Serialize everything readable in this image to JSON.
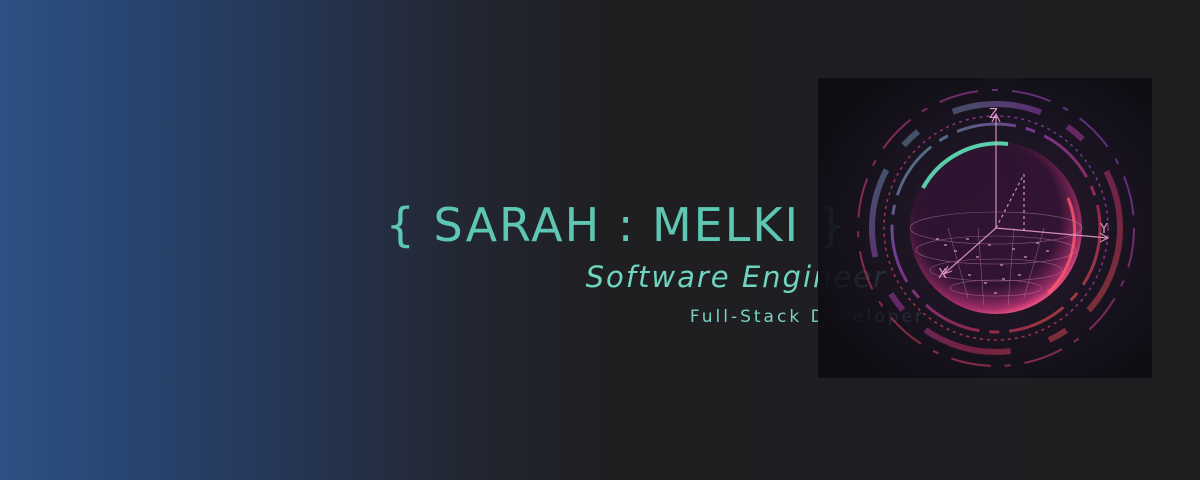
{
  "banner": {
    "name_first": "SARAH",
    "name_sep": ":",
    "name_last": "MELKI",
    "brace_open": "{",
    "brace_close": "}",
    "title": "Software Engineer",
    "subtitle": "Full-Stack Developer"
  },
  "art": {
    "axis_z": "Z",
    "axis_y": "Y",
    "axis_x": "X",
    "icon": "orb-icon"
  },
  "colors": {
    "accent": "#5dc7b3",
    "background": "#1e1e21",
    "gradient_start": "#2c5183",
    "glow_pink": "#d2358f",
    "glow_teal": "#3ad1a6",
    "glow_red": "#e1474f"
  }
}
